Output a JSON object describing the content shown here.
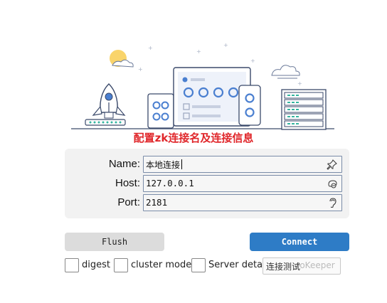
{
  "caption": "配置zk连接名及连接信息",
  "form": {
    "name_label": "Name:",
    "name_value": "本地连接",
    "host_label": "Host:",
    "host_value": "127.0.0.1",
    "port_label": "Port:",
    "port_value": "2181",
    "icons": [
      "pin-icon",
      "network-icon",
      "ear-icon"
    ]
  },
  "buttons": {
    "flush": "Flush",
    "connect": "Connect",
    "test_label": "连接测试",
    "test_overlap": "ooKeeper"
  },
  "options": [
    {
      "label": "digest",
      "checked": false
    },
    {
      "label": "cluster mode",
      "checked": false
    },
    {
      "label": "Server detail",
      "checked": false
    }
  ],
  "colors": {
    "accent": "#2e7cc6",
    "caption": "#e0262a",
    "panel": "#f2f2f2"
  }
}
